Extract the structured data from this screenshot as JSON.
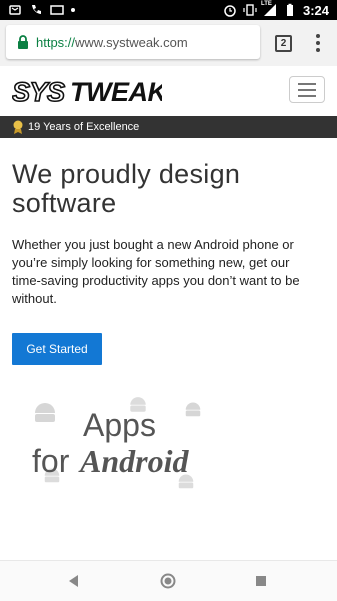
{
  "status_bar": {
    "time": "3:24",
    "network": "LTE"
  },
  "browser": {
    "url_scheme": "https://",
    "url_host": "www.systweak.com",
    "tab_count": "2"
  },
  "site": {
    "logo_text": "SYSTWEAK",
    "excellence_text": "19 Years of Excellence",
    "hero_title_line1": "We proudly design",
    "hero_title_line2": "software",
    "hero_body": "Whether you just bought a new Android phone or you’re simply looking for something new, get our time-saving productivity apps you don’t want to be without.",
    "cta_label": "Get Started",
    "graphic": {
      "apps": "Apps",
      "for": "for",
      "android": "Android"
    }
  },
  "colors": {
    "cta": "#1378d4",
    "secure_url": "#0b8043",
    "excellence_bar": "#333333"
  }
}
